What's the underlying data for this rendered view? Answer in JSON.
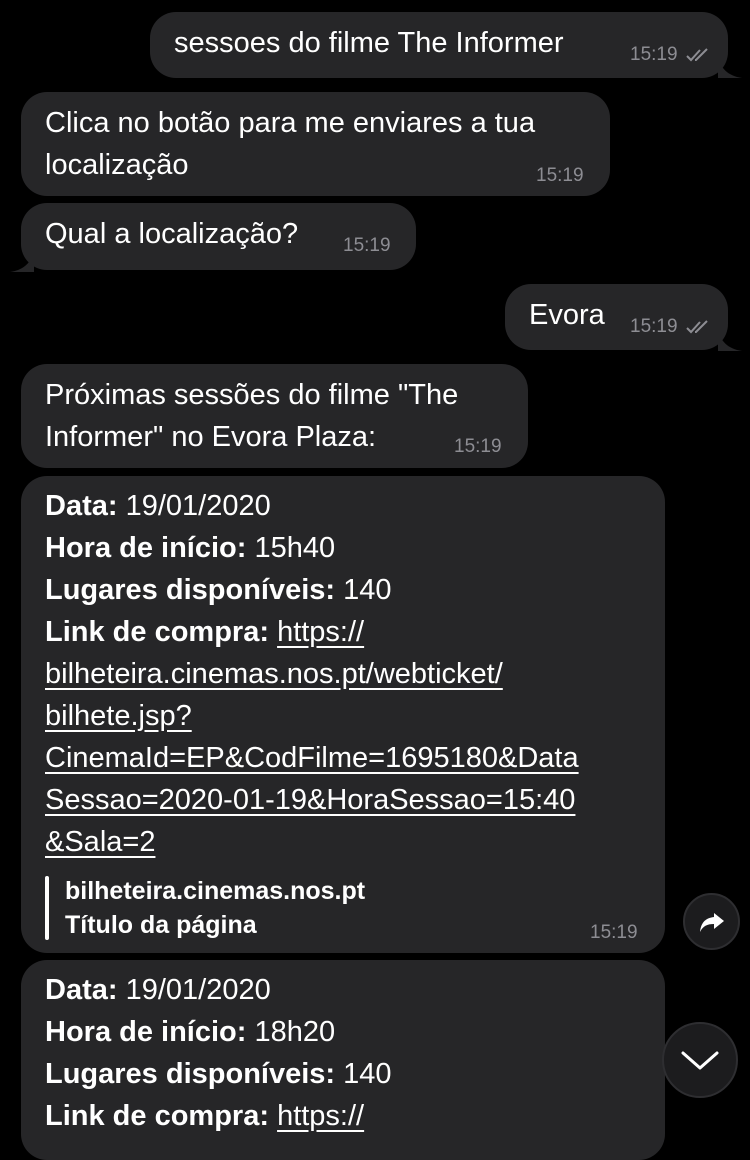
{
  "messages": {
    "m1": {
      "text": "sessoes do filme The Informer",
      "time": "15:19"
    },
    "m2": {
      "line1": "Clica no botão para me enviares a tua",
      "line2": "localização",
      "time": "15:19"
    },
    "m3": {
      "text": "Qual a localização?",
      "time": "15:19"
    },
    "m4": {
      "text": "Evora",
      "time": "15:19"
    },
    "m5": {
      "line1": "Próximas sessões do filme \"The",
      "line2": "Informer\" no Evora Plaza:",
      "time": "15:19"
    },
    "m6": {
      "date_label": "Data:",
      "date_value": " 19/01/2020",
      "start_label": "Hora de início:",
      "start_value": " 15h40",
      "seats_label": "Lugares disponíveis:",
      "seats_value": " 140",
      "link_label": "Link de compra:",
      "link_lines": [
        "https://",
        "bilheteira.cinemas.nos.pt/webticket/",
        "bilhete.jsp?",
        "CinemaId=EP&CodFilme=1695180&Data",
        "Sessao=2020-01-19&HoraSessao=15:40",
        "&Sala=2"
      ],
      "preview_site": "bilheteira.cinemas.nos.pt",
      "preview_title": "Título da página",
      "time": "15:19"
    },
    "m7": {
      "date_label": "Data:",
      "date_value": " 19/01/2020",
      "start_label": "Hora de início:",
      "start_value": " 18h20",
      "seats_label": "Lugares disponíveis:",
      "seats_value": " 140",
      "link_label": "Link de compra:",
      "link_start": "https://"
    }
  },
  "controls": {
    "forward_icon": "share-arrow-icon",
    "scroll_down_icon": "chevron-down-icon"
  },
  "colors": {
    "background": "#000000",
    "bubble": "#262628",
    "time": "#8d8d93"
  }
}
